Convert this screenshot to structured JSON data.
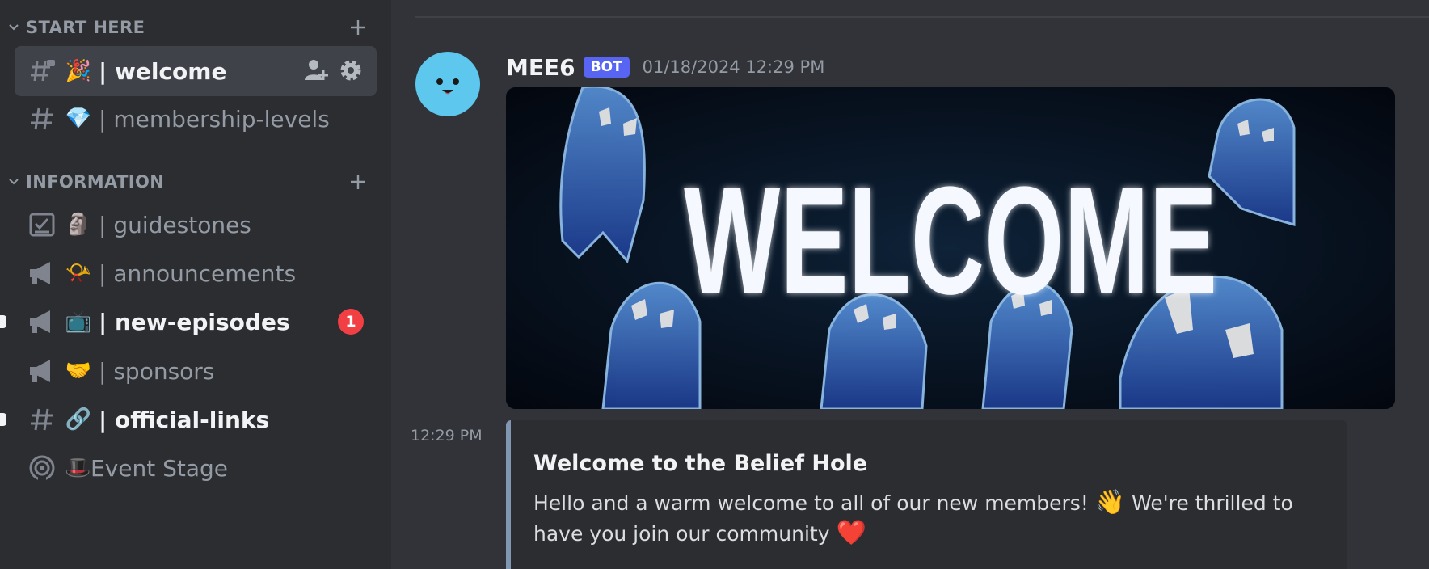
{
  "sidebar": {
    "categories": [
      {
        "label": "START HERE"
      },
      {
        "label": "INFORMATION"
      }
    ],
    "channels": [
      {
        "label": "| welcome",
        "emoji": "🎉",
        "icon": "text-channel-lock-icon"
      },
      {
        "label": "| membership-levels",
        "emoji": "💎",
        "icon": "text-channel-icon"
      },
      {
        "label": "| guidestones",
        "emoji": "🗿",
        "icon": "rules-channel-icon"
      },
      {
        "label": "| announcements",
        "emoji": "📯",
        "icon": "announcement-channel-icon"
      },
      {
        "label": "| new-episodes",
        "emoji": "📺",
        "icon": "announcement-channel-icon",
        "badge": "1"
      },
      {
        "label": "| sponsors",
        "emoji": "🤝",
        "icon": "announcement-channel-icon"
      },
      {
        "label": "| official-links",
        "emoji": "🔗",
        "icon": "text-channel-icon"
      },
      {
        "label": "Event Stage",
        "emoji": "🎩",
        "icon": "stage-channel-icon"
      }
    ]
  },
  "chat": {
    "message": {
      "author": "MEE6",
      "bot_tag": "BOT",
      "timestamp": "01/18/2024 12:29 PM",
      "image_text": "WELCOME",
      "hover_time": "12:29 PM",
      "embed": {
        "title": "Welcome to the Belief Hole",
        "description_part1": "Hello and a warm welcome to all of our new members! ",
        "wave_emoji": "👋",
        "description_part2": " We're thrilled to have you join our community ",
        "heart_emoji": "❤️"
      }
    }
  },
  "colors": {
    "sidebar_bg": "#2b2d31",
    "chat_bg": "#313338",
    "selected_bg": "#404249",
    "bot_tag": "#5865f2",
    "mention_badge": "#f23f43",
    "embed_border": "#8196b0",
    "avatar": "#5dc7ee"
  }
}
